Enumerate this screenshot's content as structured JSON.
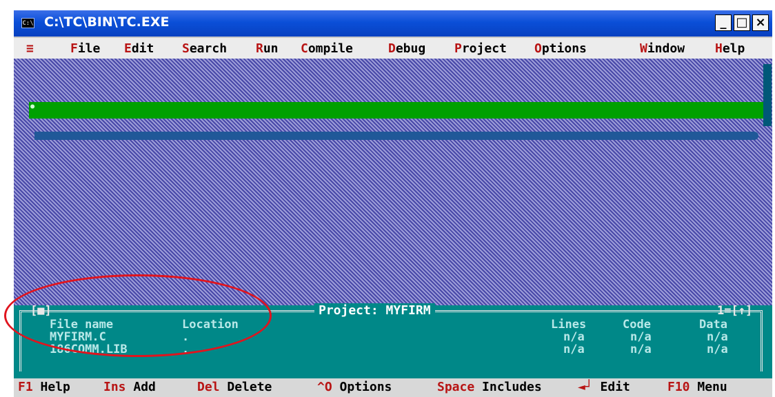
{
  "window": {
    "title": "C:\\TC\\BIN\\TC.EXE",
    "icon": "cmd-icon",
    "icon_text": "C:\\",
    "minimize_label": "_",
    "maximize_label": "□",
    "close_label": "×"
  },
  "menubar": {
    "system_menu": "≡",
    "items": [
      {
        "hot": "F",
        "rest": "ile"
      },
      {
        "hot": "E",
        "rest": "dit"
      },
      {
        "hot": "S",
        "rest": "earch"
      },
      {
        "hot": "R",
        "rest": "un"
      },
      {
        "hot": "C",
        "rest": "ompile"
      },
      {
        "hot": "D",
        "rest": "ebug"
      },
      {
        "hot": "P",
        "rest": "roject"
      },
      {
        "hot": "O",
        "rest": "ptions"
      },
      {
        "hot": "W",
        "rest": "indow"
      },
      {
        "hot": "H",
        "rest": "elp"
      }
    ]
  },
  "project_window": {
    "title": "Project: MYFIRM",
    "close_box": "[■]",
    "window_number": "1=[↑]",
    "columns": [
      "File name",
      "Location",
      "Lines",
      "Code",
      "Data"
    ],
    "rows": [
      {
        "file": "MYFIRM.C",
        "location": ".",
        "lines": "n/a",
        "code": "n/a",
        "data": "n/a"
      },
      {
        "file": "186COMM.LIB",
        "location": ".",
        "lines": "n/a",
        "code": "n/a",
        "data": "n/a"
      }
    ],
    "cursor": "•"
  },
  "statusbar": [
    {
      "key": "F1",
      "label": " Help"
    },
    {
      "key": "Ins",
      "label": " Add"
    },
    {
      "key": "Del",
      "label": " Delete"
    },
    {
      "key": "^O",
      "label": " Options"
    },
    {
      "key": "Space",
      "label": " Includes"
    },
    {
      "key": "◄┘",
      "label": " Edit"
    },
    {
      "key": "F10",
      "label": " Menu"
    }
  ],
  "colors": {
    "desktop": "#5c5cbc",
    "menu_bg": "#ececec",
    "hotkey": "#b81414",
    "project_bg": "#008888",
    "selection": "#00a000",
    "annotation_circle": "#e0141e"
  }
}
